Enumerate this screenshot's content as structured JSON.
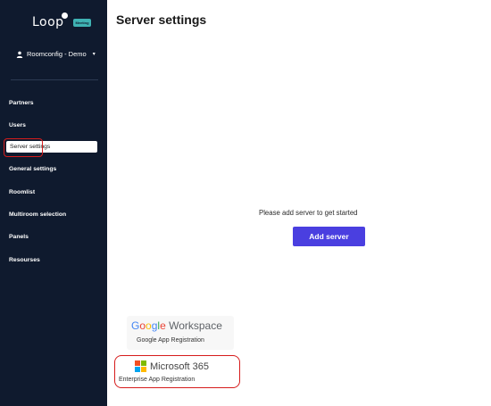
{
  "brand": {
    "logo_text": "Loop",
    "badge_text": "Meeting",
    "badge_color": "#3fb3b4"
  },
  "user": {
    "name": "Roomconfig - Demo",
    "caret": "▾"
  },
  "sidebar": {
    "items": [
      {
        "label": "Partners"
      },
      {
        "label": "Users"
      },
      {
        "label": "Server settings",
        "active": true
      },
      {
        "label": "General settings"
      },
      {
        "label": "Roomlist"
      },
      {
        "label": "Multiroom selection"
      },
      {
        "label": "Panels"
      },
      {
        "label": "Resourses"
      }
    ]
  },
  "main": {
    "title": "Server settings",
    "empty_message": "Please add server to get started",
    "add_button_label": "Add server",
    "accent_color": "#4a3fe0"
  },
  "providers": {
    "google": {
      "logo_word": "Google",
      "logo_suffix": " Workspace",
      "label": "Google App Registration"
    },
    "microsoft": {
      "logo_text": "Microsoft 365",
      "label": "Enterprise App Registration"
    }
  },
  "highlight_color": "#d61c1c"
}
